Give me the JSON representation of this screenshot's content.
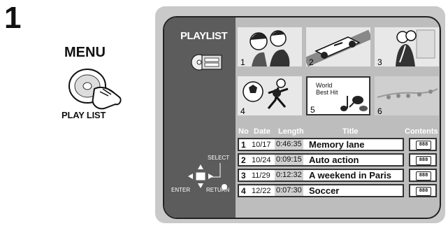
{
  "step": {
    "number": "1"
  },
  "remote": {
    "menu_label": "MENU",
    "button_label": "PLAY LIST"
  },
  "screen": {
    "title": "PLAYLIST",
    "thumbnails": [
      {
        "number": "1",
        "text": ""
      },
      {
        "number": "2",
        "text": ""
      },
      {
        "number": "3",
        "text": ""
      },
      {
        "number": "4",
        "text": ""
      },
      {
        "number": "5",
        "text": "World\nBest Hit"
      },
      {
        "number": "6",
        "text": ""
      }
    ],
    "columns": {
      "no": "No",
      "date": "Date",
      "length": "Length",
      "title": "Title",
      "contents": "Contents"
    },
    "rows": [
      {
        "no": "1",
        "date": "10/17",
        "length": "0:46:35",
        "title": "Memory lane"
      },
      {
        "no": "2",
        "date": "10/24",
        "length": "0:09:15",
        "title": "Auto action"
      },
      {
        "no": "3",
        "date": "11/29",
        "length": "0:12:32",
        "title": "A weekend in Paris"
      },
      {
        "no": "4",
        "date": "12/22",
        "length": "0:07:30",
        "title": "Soccer"
      }
    ],
    "contents_glyph": "888",
    "controls": {
      "select": "SELECT",
      "enter": "ENTER",
      "return": "RETURN"
    }
  }
}
